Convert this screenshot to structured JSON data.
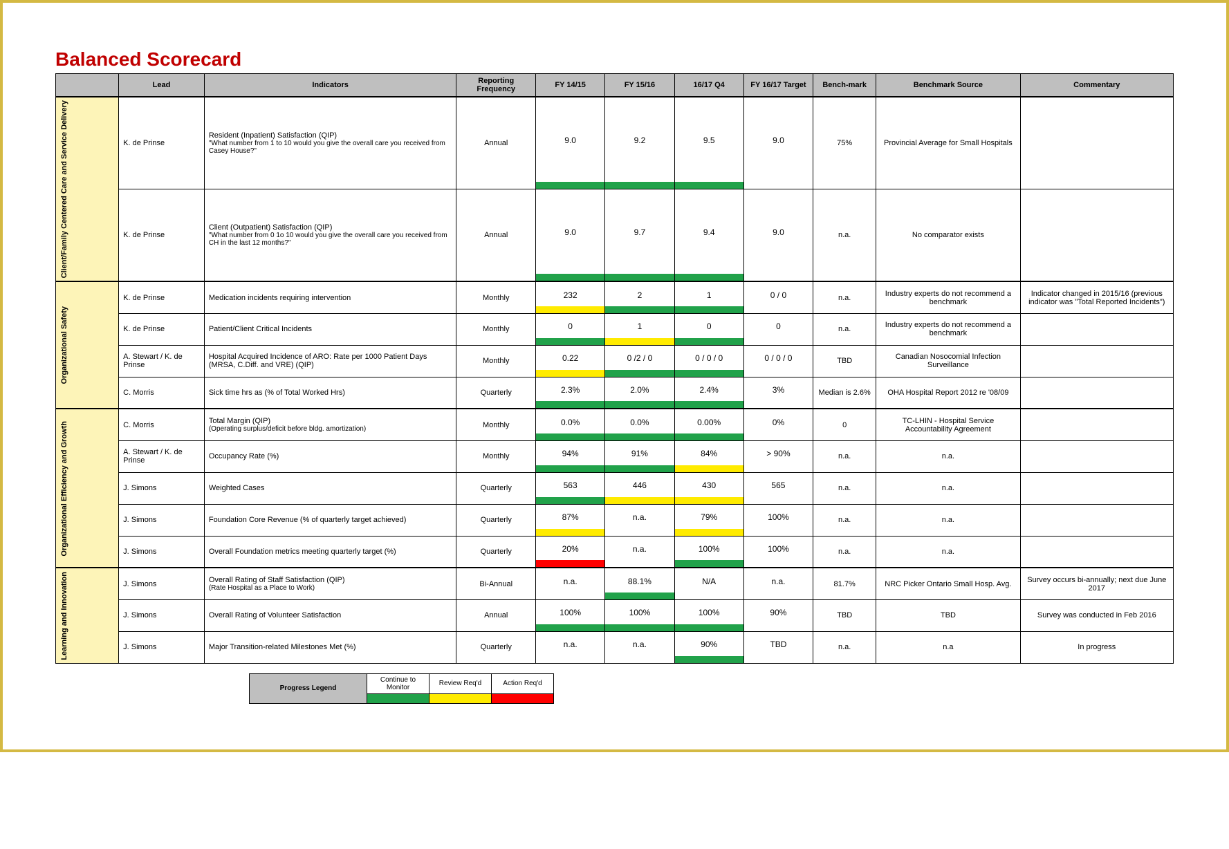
{
  "title": "Balanced Scorecard",
  "headers": {
    "lead": "Lead",
    "indicators": "Indicators",
    "freq": "Reporting Frequency",
    "fy1415": "FY 14/15",
    "fy1516": "FY 15/16",
    "q4": "16/17 Q4",
    "target": "FY 16/17 Target",
    "bench": "Bench-mark",
    "source": "Benchmark Source",
    "commentary": "Commentary"
  },
  "categories": [
    {
      "name": "Client/Family Centered Care and Service Delivery",
      "rows": 2
    },
    {
      "name": "Organizational Safety",
      "rows": 4
    },
    {
      "name": "Organizational Efficiency and Growth",
      "rows": 5
    },
    {
      "name": "Learning and Innovation",
      "rows": 3
    }
  ],
  "rows": [
    {
      "lead": "K. de Prinse",
      "indicator": "Resident (Inpatient) Satisfaction (QIP)",
      "indicator_sub": "\"What number from 1 to 10 would you give the overall care you received from Casey House?\"",
      "freq": "Annual",
      "metrics": [
        {
          "val": "9.0",
          "bar": "g"
        },
        {
          "val": "9.2",
          "bar": "g"
        },
        {
          "val": "9.5",
          "bar": "g"
        },
        {
          "val": "9.0",
          "bar": ""
        }
      ],
      "bench": "75%",
      "source": "Provincial Average for Small Hospitals",
      "commentary": ""
    },
    {
      "lead": "K. de Prinse",
      "indicator": "Client (Outpatient) Satisfaction (QIP)",
      "indicator_sub": "\"What number from 0 1o 10 would you give the overall care you received from CH in the last 12 months?\"",
      "freq": "Annual",
      "metrics": [
        {
          "val": "9.0",
          "bar": "g"
        },
        {
          "val": "9.7",
          "bar": "g"
        },
        {
          "val": "9.4",
          "bar": "g"
        },
        {
          "val": "9.0",
          "bar": ""
        }
      ],
      "bench": "n.a.",
      "source": "No comparator exists",
      "commentary": ""
    },
    {
      "lead": "K. de Prinse",
      "indicator": "Medication incidents requiring intervention",
      "indicator_sub": "",
      "freq": "Monthly",
      "metrics": [
        {
          "val": "232",
          "bar": "y"
        },
        {
          "val": "2",
          "bar": "g"
        },
        {
          "val": "1",
          "bar": "g"
        },
        {
          "val": "0 / 0",
          "bar": ""
        }
      ],
      "bench": "n.a.",
      "source": "Industry experts do not recommend a benchmark",
      "commentary": "Indicator changed in 2015/16 (previous indicator was \"Total Reported Incidents\")"
    },
    {
      "lead": "K. de Prinse",
      "indicator": "Patient/Client Critical Incidents",
      "indicator_sub": "",
      "freq": "Monthly",
      "metrics": [
        {
          "val": "0",
          "bar": "g"
        },
        {
          "val": "1",
          "bar": "y"
        },
        {
          "val": "0",
          "bar": "g"
        },
        {
          "val": "0",
          "bar": ""
        }
      ],
      "bench": "n.a.",
      "source": "Industry experts do not recommend a benchmark",
      "commentary": ""
    },
    {
      "lead": "A. Stewart / K. de Prinse",
      "indicator": "Hospital Acquired Incidence of ARO:  Rate per 1000 Patient Days (MRSA, C.Diff. and VRE) (QIP)",
      "indicator_sub": "",
      "freq": "Monthly",
      "metrics": [
        {
          "val": "0.22",
          "bar": "y"
        },
        {
          "val": "0 /2 / 0",
          "bar": "g"
        },
        {
          "val": "0 / 0 / 0",
          "bar": "g"
        },
        {
          "val": "0 / 0 / 0",
          "bar": ""
        }
      ],
      "bench": "TBD",
      "source": "Canadian Nosocomial Infection Surveillance",
      "commentary": ""
    },
    {
      "lead": "C. Morris",
      "indicator": "Sick time hrs as (% of Total Worked Hrs)",
      "indicator_sub": "",
      "freq": "Quarterly",
      "metrics": [
        {
          "val": "2.3%",
          "bar": "g"
        },
        {
          "val": "2.0%",
          "bar": "g"
        },
        {
          "val": "2.4%",
          "bar": "g"
        },
        {
          "val": "3%",
          "bar": ""
        }
      ],
      "bench": "Median is 2.6%",
      "source": "OHA Hospital Report 2012 re '08/09",
      "commentary": ""
    },
    {
      "lead": "C. Morris",
      "indicator": "Total Margin (QIP)",
      "indicator_sub": "(Operating surplus/deficit before bldg. amortization)",
      "freq": "Monthly",
      "metrics": [
        {
          "val": "0.0%",
          "bar": "g"
        },
        {
          "val": "0.0%",
          "bar": "g"
        },
        {
          "val": "0.00%",
          "bar": "g"
        },
        {
          "val": "0%",
          "bar": ""
        }
      ],
      "bench": "0",
      "source": "TC-LHIN - Hospital Service Accountability Agreement",
      "commentary": ""
    },
    {
      "lead": "A. Stewart / K. de Prinse",
      "indicator": "Occupancy Rate (%)",
      "indicator_sub": "",
      "freq": "Monthly",
      "metrics": [
        {
          "val": "94%",
          "bar": "g"
        },
        {
          "val": "91%",
          "bar": "g"
        },
        {
          "val": "84%",
          "bar": "y"
        },
        {
          "val": "> 90%",
          "bar": ""
        }
      ],
      "bench": "n.a.",
      "source": "n.a.",
      "commentary": ""
    },
    {
      "lead": "J. Simons",
      "indicator": "Weighted Cases",
      "indicator_sub": "",
      "freq": "Quarterly",
      "metrics": [
        {
          "val": "563",
          "bar": "g"
        },
        {
          "val": "446",
          "bar": "y"
        },
        {
          "val": "430",
          "bar": "y"
        },
        {
          "val": "565",
          "bar": ""
        }
      ],
      "bench": "n.a.",
      "source": "n.a.",
      "commentary": ""
    },
    {
      "lead": "J. Simons",
      "indicator": "Foundation Core Revenue (% of quarterly target achieved)",
      "indicator_sub": "",
      "freq": "Quarterly",
      "metrics": [
        {
          "val": "87%",
          "bar": "y"
        },
        {
          "val": "n.a.",
          "bar": "w"
        },
        {
          "val": "79%",
          "bar": "y"
        },
        {
          "val": "100%",
          "bar": ""
        }
      ],
      "bench": "n.a.",
      "source": "n.a.",
      "commentary": ""
    },
    {
      "lead": "J. Simons",
      "indicator": "Overall Foundation metrics meeting quarterly target (%)",
      "indicator_sub": "",
      "freq": "Quarterly",
      "metrics": [
        {
          "val": "20%",
          "bar": "r"
        },
        {
          "val": "n.a.",
          "bar": "w"
        },
        {
          "val": "100%",
          "bar": "g"
        },
        {
          "val": "100%",
          "bar": ""
        }
      ],
      "bench": "n.a.",
      "source": "n.a.",
      "commentary": ""
    },
    {
      "lead": "J. Simons",
      "indicator": "Overall Rating of Staff Satisfaction (QIP)",
      "indicator_sub": "(Rate Hospital as a Place to Work)",
      "freq": "Bi-Annual",
      "metrics": [
        {
          "val": "n.a.",
          "bar": "w"
        },
        {
          "val": "88.1%",
          "bar": "g"
        },
        {
          "val": "N/A",
          "bar": "w"
        },
        {
          "val": "n.a.",
          "bar": ""
        }
      ],
      "bench": "81.7%",
      "source": "NRC Picker\nOntario Small Hosp. Avg.",
      "commentary": "Survey occurs bi-annually; next due June 2017"
    },
    {
      "lead": "J. Simons",
      "indicator": "Overall Rating of Volunteer Satisfaction",
      "indicator_sub": "",
      "freq": "Annual",
      "metrics": [
        {
          "val": "100%",
          "bar": "g"
        },
        {
          "val": "100%",
          "bar": "g"
        },
        {
          "val": "100%",
          "bar": "g"
        },
        {
          "val": "90%",
          "bar": ""
        }
      ],
      "bench": "TBD",
      "source": "TBD",
      "commentary": "Survey was conducted in Feb 2016"
    },
    {
      "lead": "J. Simons",
      "indicator": "Major Transition-related Milestones Met (%)",
      "indicator_sub": "",
      "freq": "Quarterly",
      "metrics": [
        {
          "val": "n.a.",
          "bar": "w"
        },
        {
          "val": "n.a.",
          "bar": "w"
        },
        {
          "val": "90%",
          "bar": "g"
        },
        {
          "val": "TBD",
          "bar": ""
        }
      ],
      "bench": "n.a.",
      "source": "n.a",
      "commentary": "In progress"
    }
  ],
  "legend": {
    "label": "Progress Legend",
    "items": [
      {
        "text": "Continue to Monitor",
        "color": "g"
      },
      {
        "text": "Review Req'd",
        "color": "y"
      },
      {
        "text": "Action Req'd",
        "color": "r"
      }
    ]
  }
}
